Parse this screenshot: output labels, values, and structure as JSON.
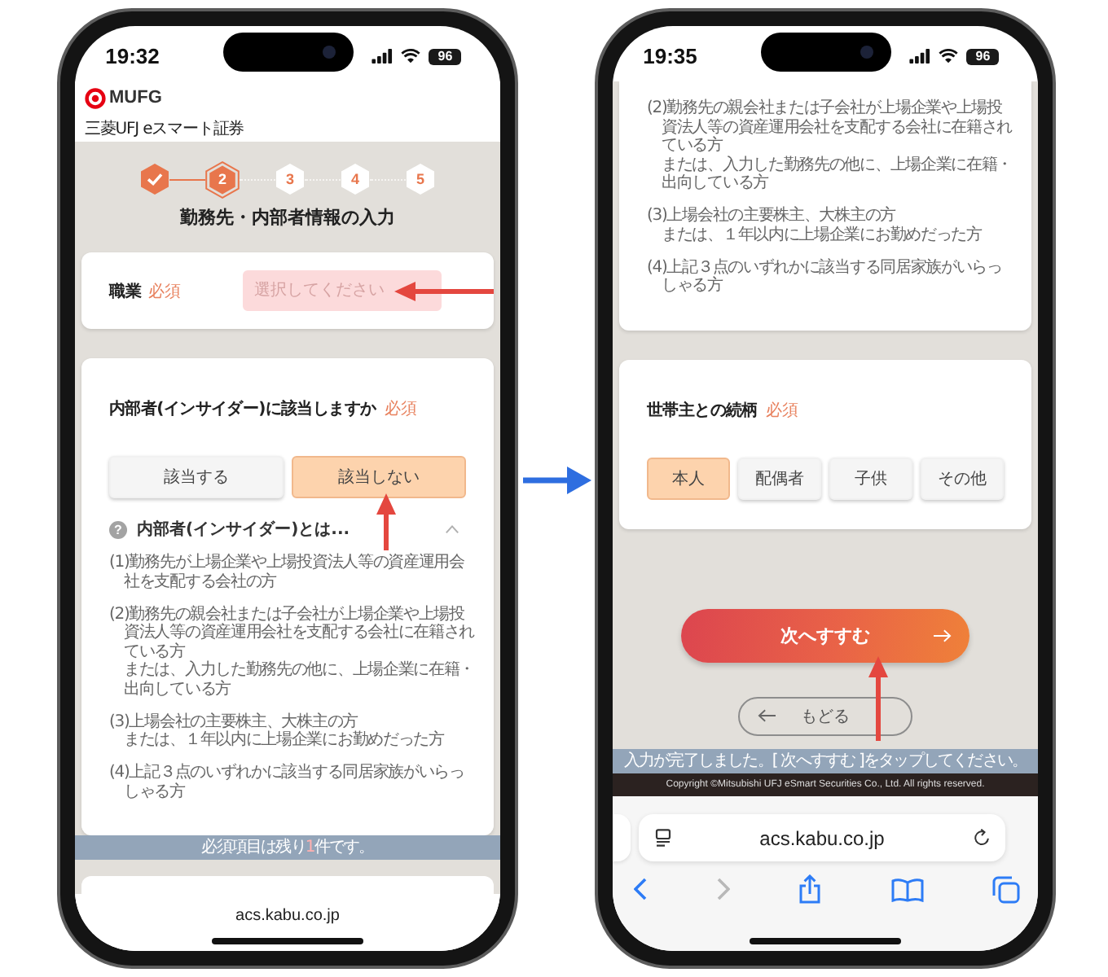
{
  "flow_arrow": true,
  "phones": [
    {
      "status_bar": {
        "time": "19:32",
        "battery": "96"
      },
      "content": [
        {
          "kind": "header",
          "logo": "MUFG",
          "subtitle": "三菱UFJ eスマート証券"
        },
        {
          "kind": "stepper",
          "steps": [
            {
              "done": true,
              "selected": false
            },
            {
              "label": "2",
              "done": false,
              "selected": true
            },
            {
              "label": "3",
              "done": false,
              "selected": false
            },
            {
              "label": "4",
              "done": false,
              "selected": false
            },
            {
              "label": "5",
              "done": false,
              "selected": false
            }
          ]
        },
        {
          "kind": "title",
          "text": "勤務先・内部者情報の入力"
        },
        {
          "kind": "field-card",
          "label": "職業",
          "required": "必須",
          "placeholder": "選択してください",
          "highlighted": true,
          "pointer_arrow": {
            "kind": "left"
          }
        },
        {
          "kind": "question-card",
          "question": "内部者(インサイダー)に該当しますか",
          "required": "必須",
          "options": [
            {
              "label": "該当する",
              "selected": false
            },
            {
              "label": "該当しない",
              "selected": true,
              "pointer_arrow": {
                "kind": "up"
              }
            }
          ],
          "accordion": {
            "icon": "?",
            "title": "内部者(インサイダー)とは...",
            "expanded": true,
            "items": [
              {
                "lines": [
                  "(1)勤務先が上場企業や上場投資法人等の資産運用会社を支配する会社の方"
                ]
              },
              {
                "lines": [
                  "(2)勤務先の親会社または子会社が上場企業や上場投資法人等の資産運用会社を支配する会社に在籍されている方",
                  "または、入力した勤務先の他に、上場企業に在籍・出向している方"
                ]
              },
              {
                "lines": [
                  "(3)上場会社の主要株主、大株主の方",
                  "または、１年以内に上場企業にお勤めだった方"
                ]
              },
              {
                "lines": [
                  "(4)上記３点のいずれかに該当する同居家族がいらっしゃる方"
                ]
              }
            ]
          }
        },
        {
          "kind": "banner",
          "text": "必須項目は残り**1**件です。"
        },
        {
          "kind": "empty-card"
        }
      ],
      "browser": {
        "url": "acs.kabu.co.jp",
        "expanded": false
      }
    },
    {
      "status_bar": {
        "time": "19:35",
        "battery": "96"
      },
      "content": [
        {
          "kind": "list-card",
          "items": [
            {
              "lines": [
                "(2)勤務先の親会社または子会社が上場企業や上場投資法人等の資産運用会社を支配する会社に在籍されている方",
                "または、入力した勤務先の他に、上場企業に在籍・出向している方"
              ]
            },
            {
              "lines": [
                "(3)上場会社の主要株主、大株主の方",
                "または、１年以内に上場企業にお勤めだった方"
              ]
            },
            {
              "lines": [
                "(4)上記３点のいずれかに該当する同居家族がいらっしゃる方"
              ]
            }
          ]
        },
        {
          "kind": "question-card",
          "question": "世帯主との続柄",
          "required": "必須",
          "options": [
            {
              "label": "本人",
              "selected": true
            },
            {
              "label": "配偶者",
              "selected": false
            },
            {
              "label": "子供",
              "selected": false
            },
            {
              "label": "その他",
              "selected": false
            }
          ]
        },
        {
          "kind": "primary-button",
          "label": "次へすすむ",
          "pointer_arrow": {
            "kind": "up"
          }
        },
        {
          "kind": "back-button",
          "label": "もどる"
        },
        {
          "kind": "banner",
          "text": "入力が完了しました。[ 次へすすむ ]をタップしてください。"
        },
        {
          "kind": "footer",
          "text": "Copyright ©Mitsubishi UFJ eSmart Securities Co., Ltd. All rights reserved."
        }
      ],
      "browser": {
        "url": "acs.kabu.co.jp",
        "expanded": true,
        "toolbar": [
          {
            "kind": "back",
            "disabled": false
          },
          {
            "kind": "forward",
            "disabled": true
          },
          {
            "kind": "share",
            "disabled": false
          },
          {
            "kind": "bookmarks",
            "disabled": false
          },
          {
            "kind": "tabs",
            "disabled": false
          }
        ]
      }
    }
  ]
}
